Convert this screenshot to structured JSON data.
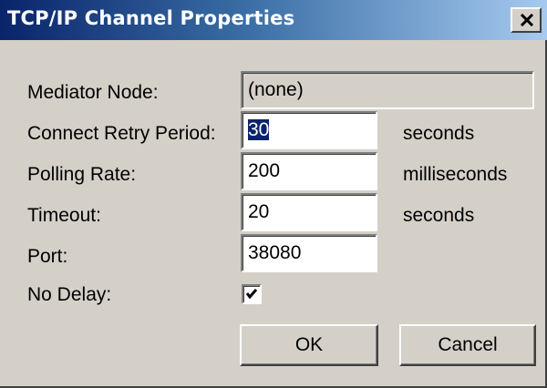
{
  "dialog": {
    "title": "TCP/IP Channel Properties",
    "close_icon": "close-x-icon"
  },
  "fields": {
    "mediator_node": {
      "label": "Mediator Node:",
      "value": "(none)"
    },
    "connect_retry_period": {
      "label": "Connect Retry Period:",
      "value": "30",
      "unit": "seconds"
    },
    "polling_rate": {
      "label": "Polling Rate:",
      "value": "200",
      "unit": "milliseconds"
    },
    "timeout": {
      "label": "Timeout:",
      "value": "20",
      "unit": "seconds"
    },
    "port": {
      "label": "Port:",
      "value": "38080"
    },
    "no_delay": {
      "label": "No Delay:",
      "checked": true
    }
  },
  "buttons": {
    "ok_label": "OK",
    "cancel_label": "Cancel"
  },
  "colors": {
    "titlebar_start": "#0a246a",
    "titlebar_end": "#a6caf0",
    "face": "#d4d0c8",
    "selection": "#0a246a"
  }
}
